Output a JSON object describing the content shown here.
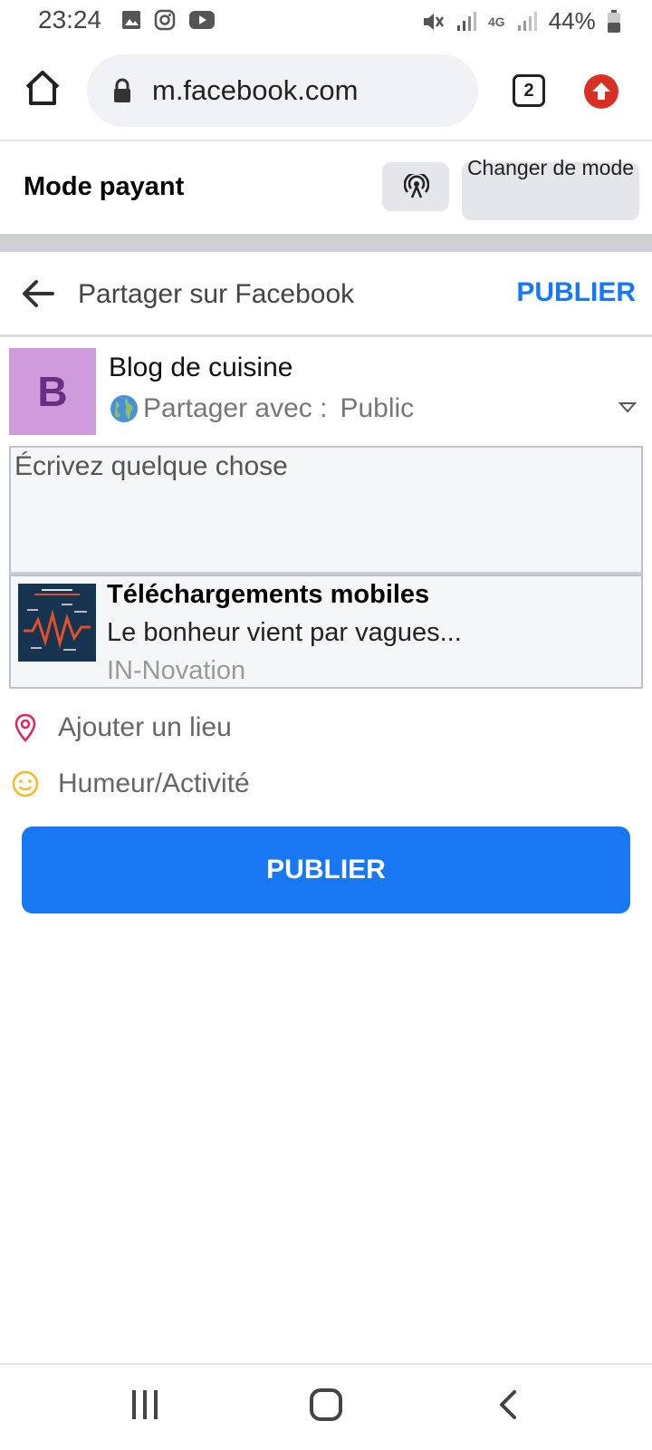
{
  "status_bar": {
    "time": "23:24",
    "battery": "44%",
    "network": "4G"
  },
  "browser": {
    "url": "m.facebook.com",
    "tab_count": "2"
  },
  "mode_bar": {
    "title": "Mode payant",
    "change_mode_label": "Changer de mode"
  },
  "share_header": {
    "title": "Partager sur Facebook",
    "publish_label": "PUBLIER"
  },
  "author": {
    "avatar_letter": "B",
    "name": "Blog de cuisine",
    "audience_prefix": "Partager avec :",
    "audience_value": "Public"
  },
  "composer": {
    "placeholder": "Écrivez quelque chose"
  },
  "link_card": {
    "title": "Téléchargements mobiles",
    "description": "Le bonheur vient par vagues...",
    "source": "IN-Novation"
  },
  "options": {
    "location": "Ajouter un lieu",
    "mood": "Humeur/Activité"
  },
  "publish_button": "PUBLIER",
  "colors": {
    "accent": "#1877f2",
    "avatar_bg": "#cf9bdc",
    "location_icon": "#e0245e",
    "mood_icon": "#f7b928"
  }
}
